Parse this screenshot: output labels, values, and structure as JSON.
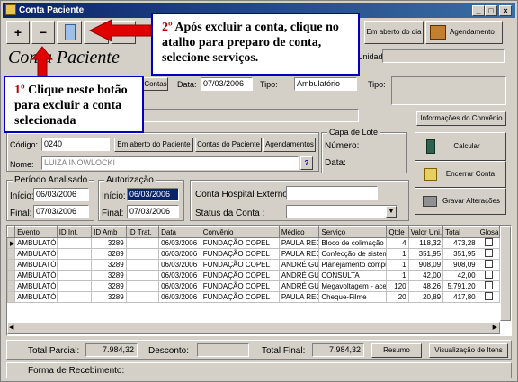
{
  "window": {
    "title": "Conta Paciente",
    "min": "_",
    "max": "□",
    "close": "×"
  },
  "toolbar": {
    "add": "+",
    "remove": "−",
    "aberto_dia": "Em aberto do dia",
    "agendamento": "Agendamento",
    "contas_label": "Contas",
    "tipo_label": "Tipo:",
    "tipo_value": "Ambulatório",
    "data_label": "Data:",
    "data_value": "07/03/2006",
    "lote_label": "Unidade:",
    "info_convenio": "Informações do Convênio"
  },
  "page_title": "Conta Paciente",
  "callouts": {
    "c1_num": "1º",
    "c1_text": " Clique neste botão para excluir a conta selecionada",
    "c2_num": "2º",
    "c2_text": " Após excluir a conta, clique no atalho para preparo de conta, selecione serviços."
  },
  "patient": {
    "codigo_label": "Código:",
    "codigo": "0240",
    "btn_aberto": "Em aberto do Paciente",
    "btn_contas": "Contas do Paciente",
    "btn_agend": "Agendamentos",
    "nome_label": "Nome:",
    "nome": "LUIZA INOWLOCKI",
    "help": "?"
  },
  "lote": {
    "title": "Capa de Lote",
    "numero": "Número:",
    "data": "Data:"
  },
  "actions": {
    "calcular": "Calcular",
    "encerrar": "Encerrar Conta",
    "gravar": "Gravar Alterações"
  },
  "periodo": {
    "title": "Período Analisado",
    "inicio_label": "Início:",
    "inicio": "06/03/2006",
    "final_label": "Final:",
    "final": "07/03/2006"
  },
  "autorizacao": {
    "title": "Autorização",
    "inicio_label": "Início:",
    "inicio": "06/03/2006",
    "final_label": "Final:",
    "final": "07/03/2006"
  },
  "externo": {
    "conta_label": "Conta Hospital Externo:",
    "status_label": "Status da Conta :"
  },
  "table": {
    "headers": [
      "Evento",
      "ID Int.",
      "ID Amb",
      "ID Trat.",
      "Data",
      "Convênio",
      "Médico",
      "Serviço",
      "Qtde",
      "Valor Uni.",
      "Total",
      "Glosa"
    ],
    "rows": [
      [
        "AMBULATÓR",
        "",
        "3289",
        "",
        "06/03/2006",
        "FUNDAÇÃO COPEL",
        "PAULA REG",
        "Bloco de colimação ind",
        "4",
        "118,32",
        "473,28"
      ],
      [
        "AMBULATÓR",
        "",
        "3289",
        "",
        "06/03/2006",
        "FUNDAÇÃO COPEL",
        "PAULA REG",
        "Confecção de sistema c",
        "1",
        "351,95",
        "351,95"
      ],
      [
        "AMBULATÓR",
        "",
        "3289",
        "",
        "06/03/2006",
        "FUNDAÇÃO COPEL",
        "ANDRÉ GUI",
        "Planejamento computa",
        "1",
        "908,09",
        "908,09"
      ],
      [
        "AMBULATÓR",
        "",
        "3289",
        "",
        "06/03/2006",
        "FUNDAÇÃO COPEL",
        "ANDRÉ GUI",
        "CONSULTA",
        "1",
        "42,00",
        "42,00"
      ],
      [
        "AMBULATÓR",
        "",
        "3289",
        "",
        "06/03/2006",
        "FUNDAÇÃO COPEL",
        "ANDRÉ GUI",
        "Megavoltagem - acelera",
        "120",
        "48,26",
        "5.791,20"
      ],
      [
        "AMBULATÓR",
        "",
        "3289",
        "",
        "06/03/2006",
        "FUNDAÇÃO COPEL",
        "PAULA REG",
        "Cheque-Filme",
        "20",
        "20,89",
        "417,80"
      ]
    ]
  },
  "footer": {
    "parcial_label": "Total Parcial:",
    "parcial": "7.984,32",
    "desconto_label": "Desconto:",
    "final_label": "Total Final:",
    "final": "7.984,32",
    "resumo": "Resumo",
    "visualizacao": "Visualização de Itens",
    "forma_label": "Forma de Recebimento:"
  }
}
